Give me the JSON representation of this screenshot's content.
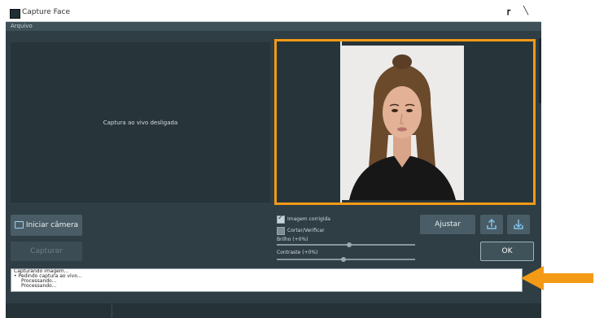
{
  "window": {
    "title": "Capture Face"
  },
  "menu": {
    "items": [
      "Arquivo"
    ]
  },
  "left_panel": {
    "message": "Captura ao vivo desligada"
  },
  "buttons": {
    "start_camera": "Iniciar câmera",
    "capture": "Capturar",
    "adjust": "Ajustar",
    "ok": "OK"
  },
  "options": {
    "checkbox_corrected": {
      "label": "Imagem corrigida",
      "checked": true
    },
    "checkbox_second": {
      "label": "Cortar/Verificar",
      "checked": false
    },
    "brightness": {
      "label": "Brilho (+0%)",
      "value": 0.5
    },
    "contrast": {
      "label": "Contraste (+0%)",
      "value": 0.5
    }
  },
  "log": {
    "lines": [
      "Capturando imagem...",
      "• Pedindo captura ao vivo...",
      "Processando...",
      "Processando..."
    ]
  },
  "colors": {
    "accent_orange": "#f39a17",
    "panel_bg": "#27343a",
    "window_bg": "#2f3e45"
  }
}
